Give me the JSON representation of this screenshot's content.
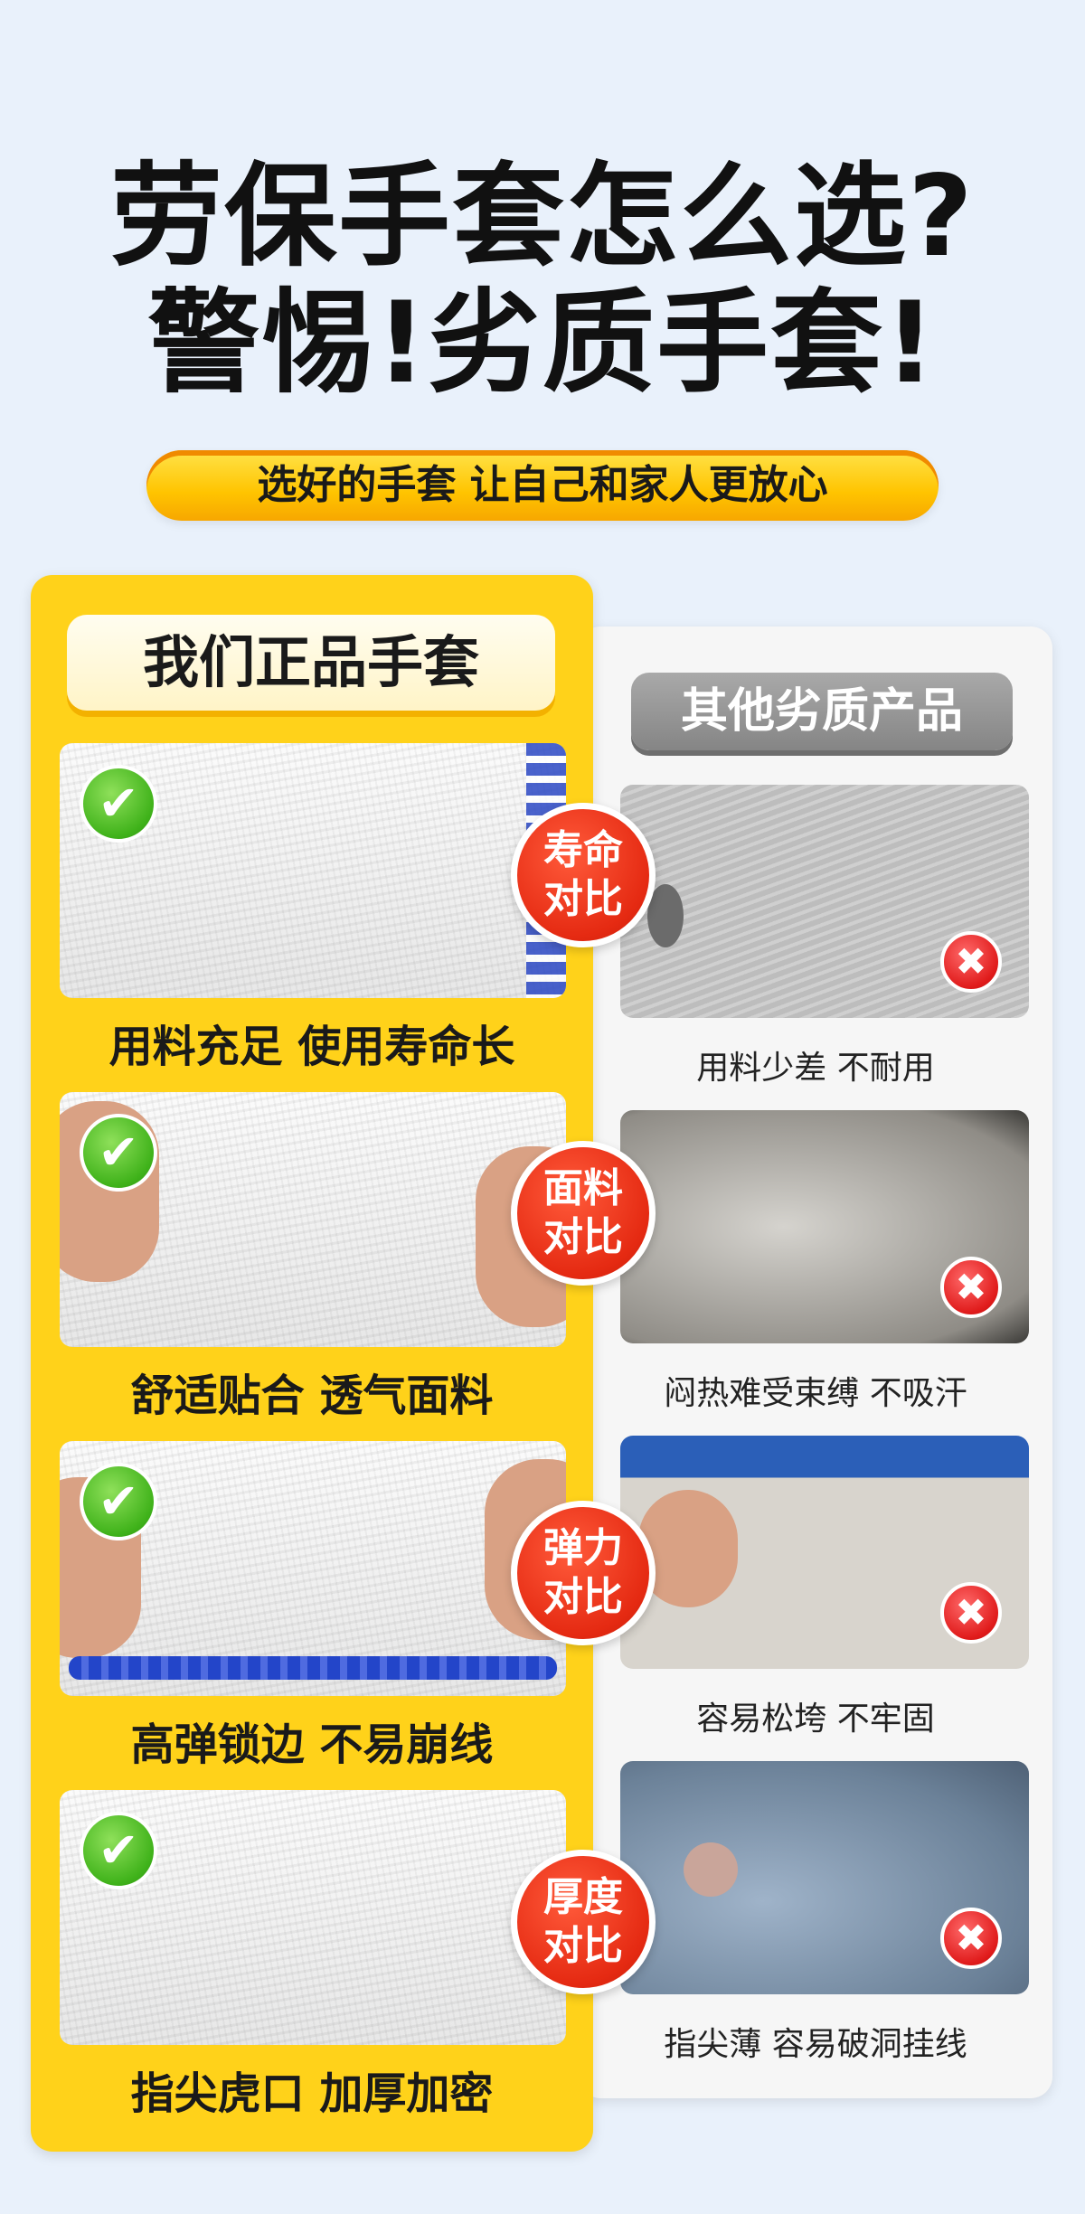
{
  "headline": {
    "line1": "劳保手套怎么选?",
    "line2": "警惕!劣质手套!"
  },
  "subtitle_pill": "选好的手套 让自己和家人更放心",
  "left_panel": {
    "title": "我们正品手套",
    "items": [
      {
        "caption": "用料充足 使用寿命长",
        "check_icon": "check-icon"
      },
      {
        "caption": "舒适贴合 透气面料",
        "check_icon": "check-icon"
      },
      {
        "caption": "高弹锁边 不易崩线",
        "check_icon": "check-icon"
      },
      {
        "caption": "指尖虎口 加厚加密",
        "check_icon": "check-icon"
      }
    ]
  },
  "right_panel": {
    "title": "其他劣质产品",
    "items": [
      {
        "caption": "用料少差 不耐用",
        "x_icon": "cross-icon"
      },
      {
        "caption": "闷热难受束缚 不吸汗",
        "x_icon": "cross-icon"
      },
      {
        "caption": "容易松垮 不牢固",
        "x_icon": "cross-icon"
      },
      {
        "caption": "指尖薄 容易破洞挂线",
        "x_icon": "cross-icon"
      }
    ]
  },
  "badges": [
    {
      "line1": "寿命",
      "line2": "对比"
    },
    {
      "line1": "面料",
      "line2": "对比"
    },
    {
      "line1": "弹力",
      "line2": "对比"
    },
    {
      "line1": "厚度",
      "line2": "对比"
    }
  ],
  "glyphs": {
    "check": "✔",
    "cross": "✖"
  },
  "colors": {
    "background": "#e9f1fb",
    "yellow_panel": "#ffd21a",
    "badge_red": "#e52a12",
    "check_green": "#3fb21a",
    "cross_red": "#e01b1b"
  }
}
